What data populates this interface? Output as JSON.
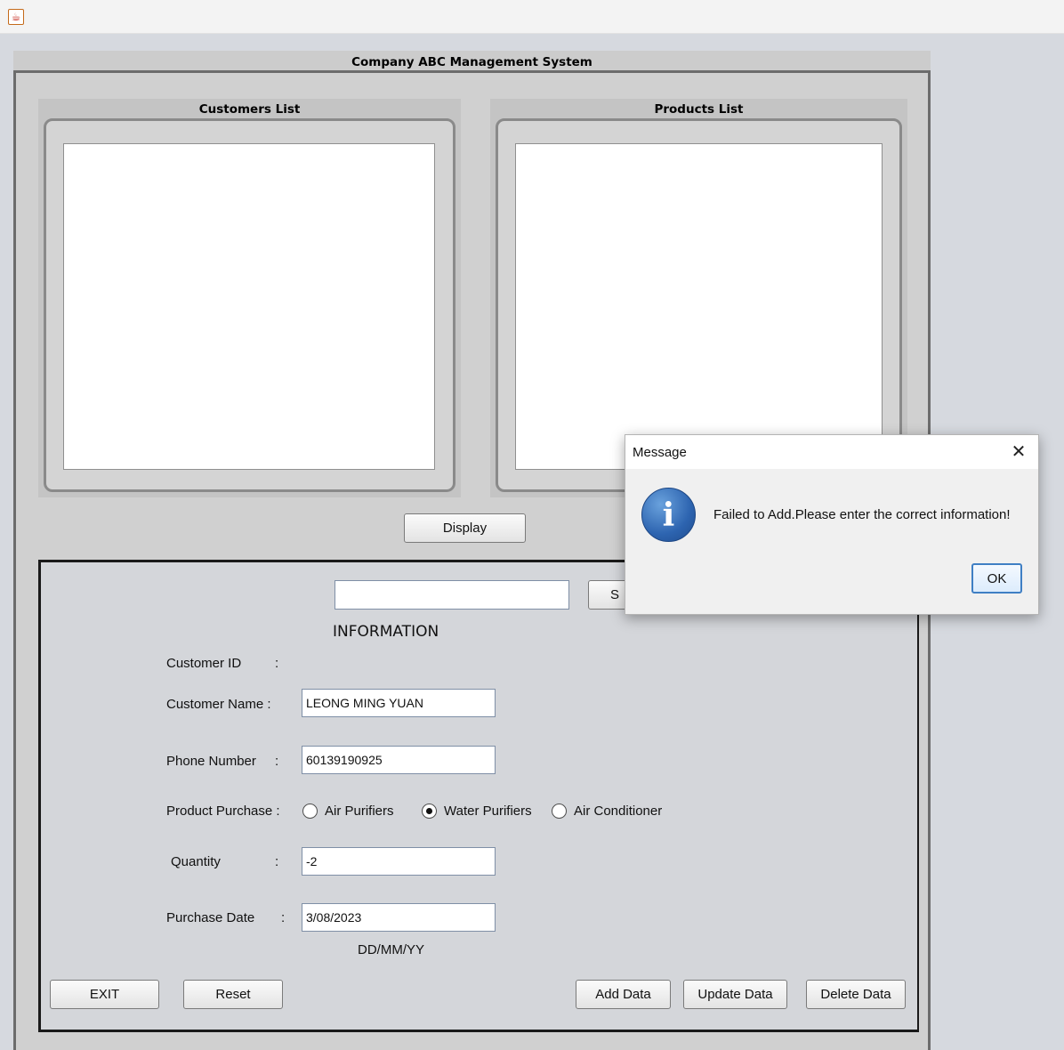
{
  "window": {
    "icon": "java-cup-icon"
  },
  "main": {
    "title": "Company ABC Management System",
    "customers_list_title": "Customers List",
    "products_list_title": "Products List",
    "display_label": "Display"
  },
  "info": {
    "search_value": "",
    "search_button_label": "S",
    "title": "INFORMATION",
    "customer_id_label": "Customer ID",
    "customer_id_colon": ":",
    "customer_name_label": "Customer Name :",
    "customer_name_value": "LEONG MING YUAN",
    "phone_label": "Phone Number",
    "phone_colon": ":",
    "phone_value": "60139190925",
    "product_purchase_label": "Product Purchase :",
    "products": [
      {
        "label": "Air Purifiers",
        "selected": false
      },
      {
        "label": "Water Purifiers",
        "selected": true
      },
      {
        "label": "Air Conditioner",
        "selected": false
      }
    ],
    "quantity_label": "Quantity",
    "quantity_colon": ":",
    "quantity_value": "-2",
    "purchase_date_label": "Purchase Date",
    "purchase_date_colon": ":",
    "purchase_date_value": "3/08/2023",
    "date_format_hint": "DD/MM/YY"
  },
  "buttons": {
    "exit": "EXIT",
    "reset": "Reset",
    "add": "Add Data",
    "update": "Update Data",
    "delete": "Delete Data"
  },
  "dialog": {
    "title": "Message",
    "close_glyph": "✕",
    "icon": "information-icon",
    "icon_glyph": "i",
    "message": "Failed to Add.Please enter the correct information!",
    "ok_label": "OK"
  }
}
